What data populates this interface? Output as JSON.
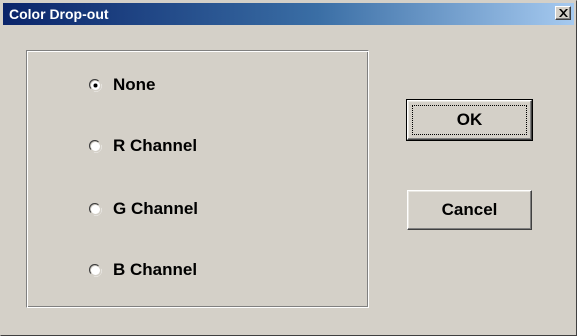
{
  "dialog": {
    "title": "Color Drop-out",
    "close_icon": "close-icon"
  },
  "options": [
    {
      "label": "None",
      "checked": true
    },
    {
      "label": "R Channel",
      "checked": false
    },
    {
      "label": "G Channel",
      "checked": false
    },
    {
      "label": "B Channel",
      "checked": false
    }
  ],
  "buttons": {
    "ok_label": "OK",
    "cancel_label": "Cancel"
  },
  "colors": {
    "face": "#d4d0c8",
    "title_start": "#0a246a",
    "title_end": "#a6caf0"
  }
}
